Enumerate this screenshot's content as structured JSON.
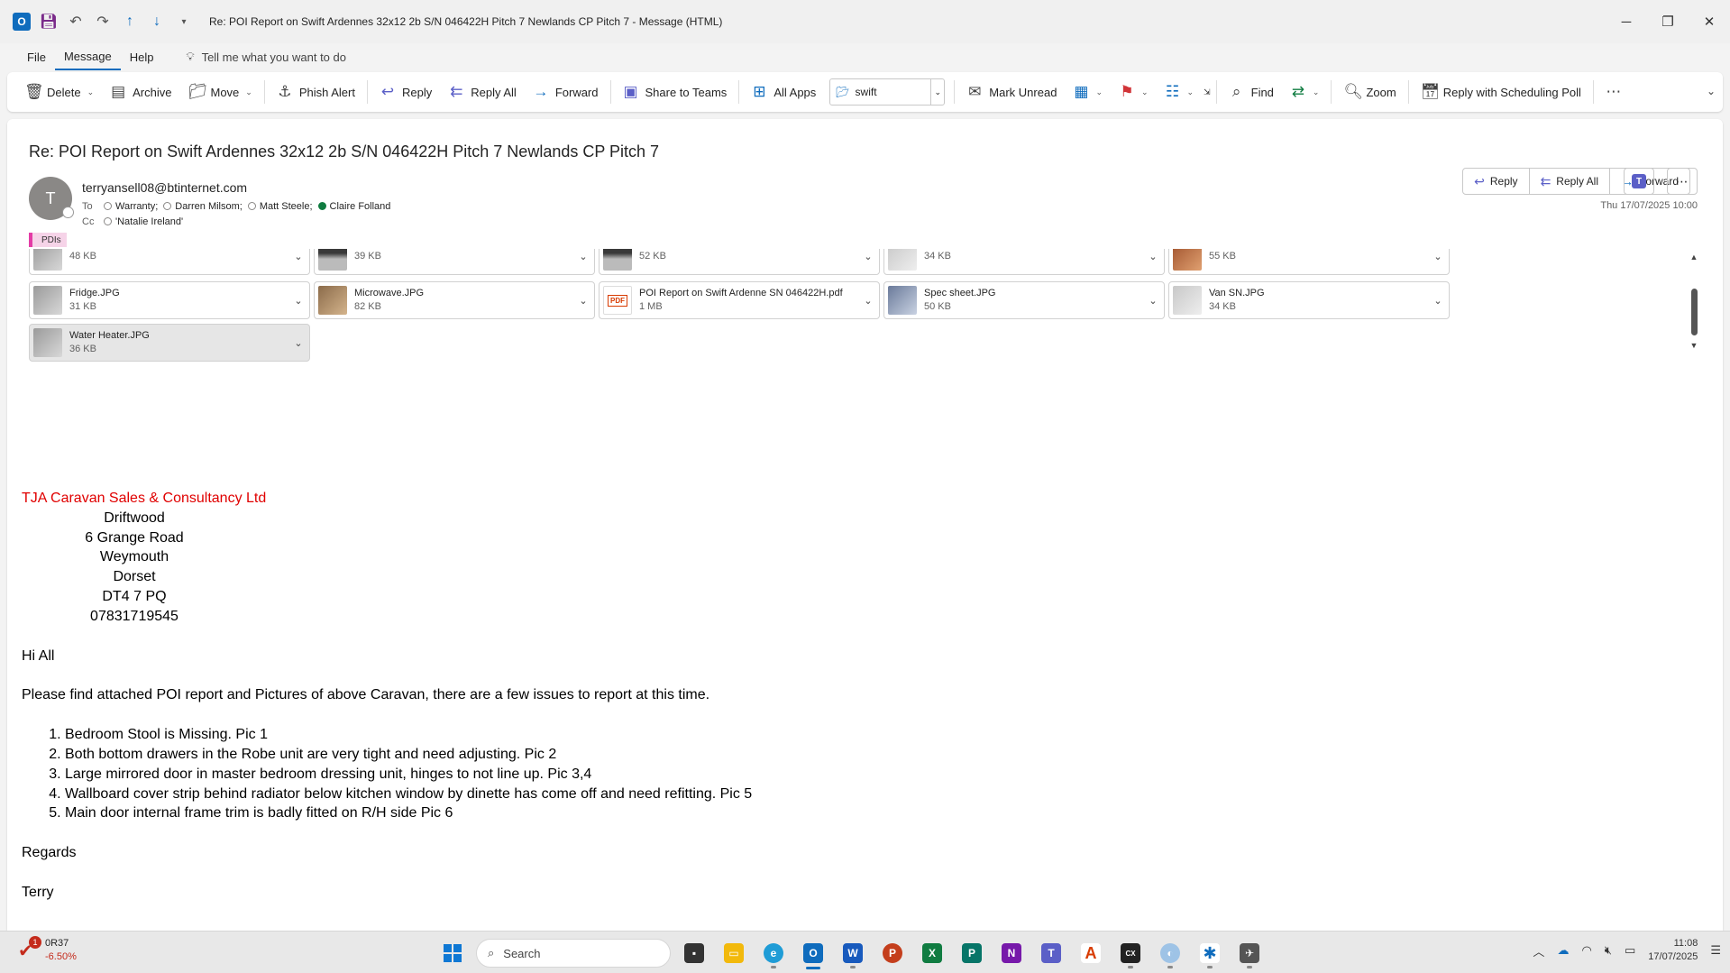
{
  "window": {
    "title": "Re: POI Report on Swift Ardennes 32x12 2b S/N 046422H Pitch 7 Newlands CP Pitch 7  -  Message (HTML)"
  },
  "menu": {
    "items": [
      "File",
      "Message",
      "Help"
    ],
    "tellme": "Tell me what you want to do"
  },
  "ribbon": {
    "delete": "Delete",
    "archive": "Archive",
    "move": "Move",
    "phish_alert": "Phish Alert",
    "reply": "Reply",
    "reply_all": "Reply All",
    "forward": "Forward",
    "share_teams": "Share to Teams",
    "all_apps": "All Apps",
    "quickstep_value": "swift",
    "mark_unread": "Mark Unread",
    "find": "Find",
    "zoom": "Zoom",
    "reply_poll": "Reply with Scheduling Poll"
  },
  "message": {
    "subject": "Re: POI Report on Swift Ardennes 32x12 2b S/N 046422H Pitch 7 Newlands CP Pitch 7",
    "avatar_initial": "T",
    "sender": "terryansell08@btinternet.com",
    "to_label": "To",
    "cc_label": "Cc",
    "to": [
      "Warranty;",
      "Darren Milsom;",
      "Matt Steele;",
      "Claire Folland"
    ],
    "cc": [
      "'Natalie Ireland'"
    ],
    "category": "PDIs",
    "date": "Thu 17/07/2025 10:00",
    "actions": {
      "reply": "Reply",
      "reply_all": "Reply All",
      "forward": "Forward"
    }
  },
  "attachments": {
    "row0": [
      {
        "name": "",
        "size": "48 KB"
      },
      {
        "name": "",
        "size": "39 KB"
      },
      {
        "name": "",
        "size": "52 KB"
      },
      {
        "name": "",
        "size": "34 KB"
      },
      {
        "name": "",
        "size": "55 KB"
      }
    ],
    "row1": [
      {
        "name": "Fridge.JPG",
        "size": "31 KB"
      },
      {
        "name": "Microwave.JPG",
        "size": "82 KB"
      },
      {
        "name": "POI Report on Swift Ardenne SN 046422H.pdf",
        "size": "1 MB"
      },
      {
        "name": "Spec sheet.JPG",
        "size": "50 KB"
      },
      {
        "name": "Van SN.JPG",
        "size": "34 KB"
      }
    ],
    "row2": [
      {
        "name": "Water Heater.JPG",
        "size": "36 KB"
      }
    ]
  },
  "body": {
    "company": "TJA Caravan Sales & Consultancy Ltd",
    "address": [
      "Driftwood",
      "6 Grange Road",
      "Weymouth",
      "Dorset",
      "DT4 7 PQ",
      "07831719545"
    ],
    "greeting": "Hi All",
    "intro": "Please find attached POI report and Pictures of above Caravan, there are a few issues to report at this time.",
    "issues": [
      "Bedroom Stool is Missing. Pic 1",
      "Both bottom drawers in the Robe unit are very tight and need adjusting. Pic 2",
      "Large mirrored door in master bedroom dressing unit, hinges to not line up. Pic 3,4",
      "Wallboard cover strip behind radiator below kitchen window by dinette has come off and need refitting. Pic 5",
      "Main door internal frame trim is badly fitted on R/H side Pic 6"
    ],
    "closing": "Regards",
    "signature": "Terry"
  },
  "taskbar": {
    "stock_name": "0R37",
    "stock_change": "-6.50%",
    "notification_count": "1",
    "search": "Search",
    "time": "11:08",
    "date": "17/07/2025"
  }
}
